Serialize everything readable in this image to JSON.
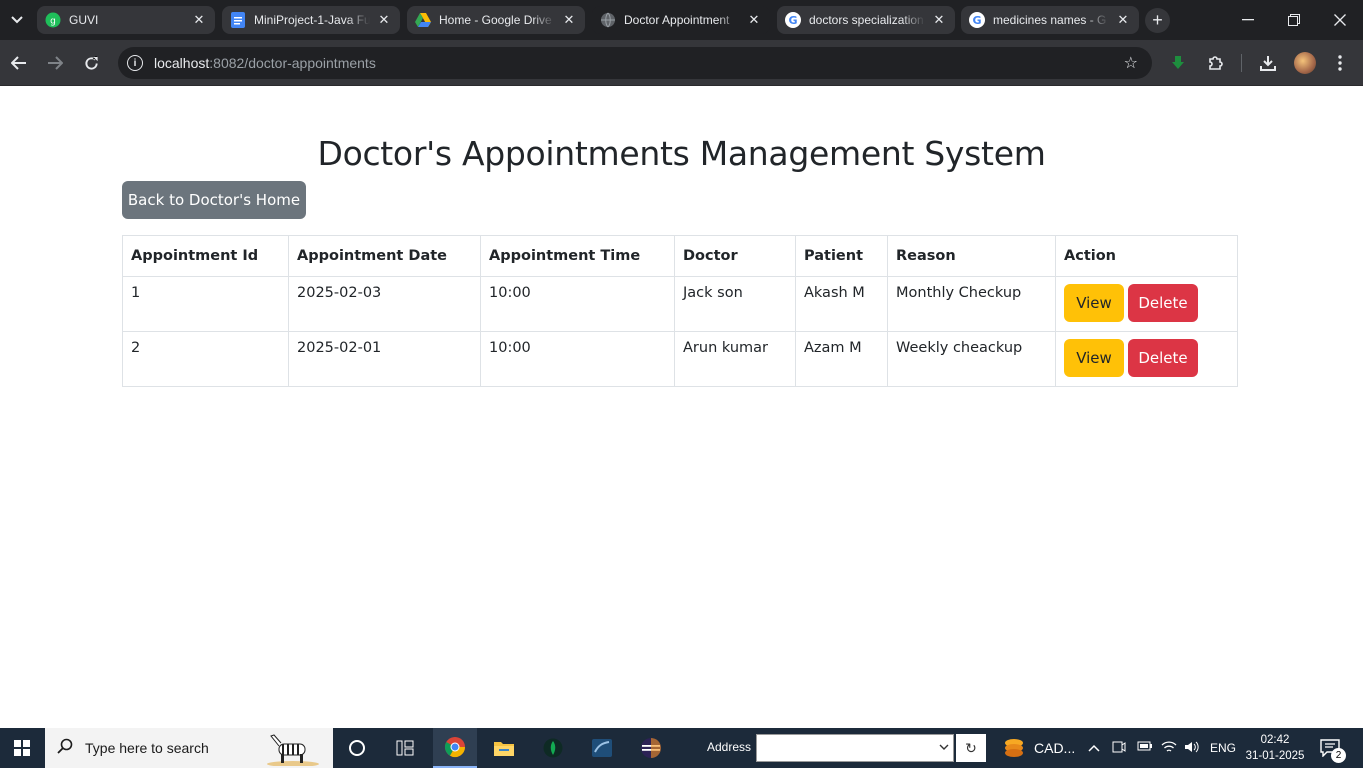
{
  "browser": {
    "tabs": [
      {
        "title": "GUVI",
        "favicon": "guvi-icon",
        "active": false
      },
      {
        "title": "MiniProject-1-Java Fu",
        "favicon": "google-docs-icon",
        "active": false
      },
      {
        "title": "Home - Google Drive",
        "favicon": "google-drive-icon",
        "active": false
      },
      {
        "title": "Doctor Appointment",
        "favicon": "globe-icon",
        "active": true
      },
      {
        "title": "doctors specialization",
        "favicon": "google-icon",
        "active": false
      },
      {
        "title": "medicines names - G",
        "favicon": "google-icon",
        "active": false
      }
    ],
    "url_host": "localhost",
    "url_path": ":8082/doctor-appointments"
  },
  "page": {
    "title": "Doctor's Appointments Management System",
    "back_label": "Back to Doctor's Home",
    "table": {
      "headers": [
        "Appointment Id",
        "Appointment Date",
        "Appointment Time",
        "Doctor",
        "Patient",
        "Reason",
        "Action"
      ],
      "rows": [
        {
          "id": "1",
          "date": "2025-02-03",
          "time": "10:00",
          "doctor": "Jack son",
          "patient": "Akash M",
          "reason": "Monthly Checkup"
        },
        {
          "id": "2",
          "date": "2025-02-01",
          "time": "10:00",
          "doctor": "Arun kumar",
          "patient": "Azam M",
          "reason": "Weekly cheackup"
        }
      ],
      "view_label": "View",
      "delete_label": "Delete"
    }
  },
  "taskbar": {
    "search_placeholder": "Type here to search",
    "address_label": "Address",
    "cad_label": "CAD...",
    "language": "ENG",
    "time": "02:42",
    "date": "31-01-2025",
    "notification_count": "2"
  },
  "colors": {
    "secondary_button": "#6c757d",
    "view_button": "#ffc107",
    "delete_button": "#dc3545"
  }
}
